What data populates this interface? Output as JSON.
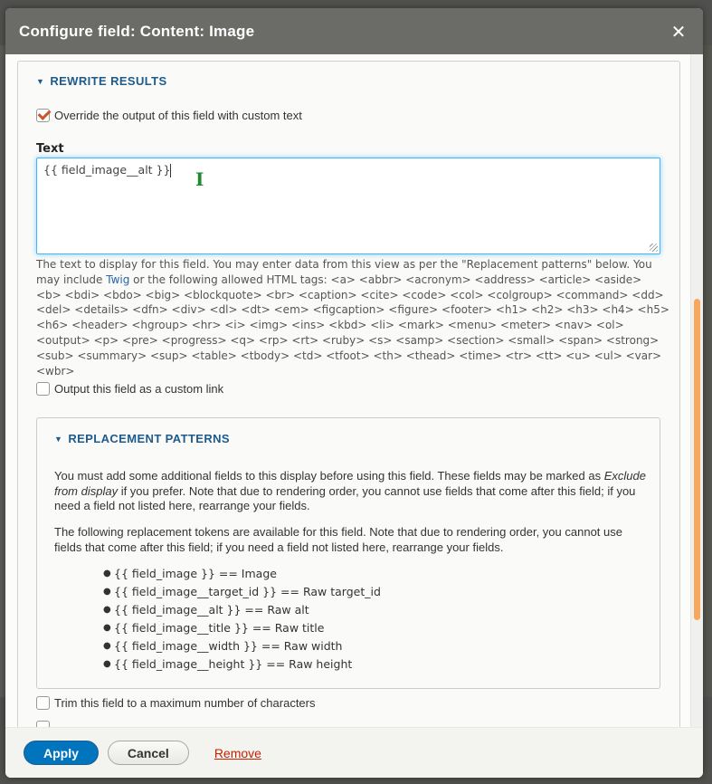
{
  "dialog": {
    "title": "Configure field: Content: Image",
    "close_icon": "close-icon"
  },
  "rewrite": {
    "legend": "REWRITE RESULTS",
    "override_checkbox": {
      "label": "Override the output of this field with custom text",
      "checked": true
    },
    "text_label": "Text",
    "text_value": "{{ field_image__alt }}",
    "help_prefix": "The text to display for this field. You may enter data from this view as per the \"Replacement patterns\" below. You may include ",
    "help_link": "Twig",
    "help_suffix": " or the following allowed HTML tags: <a> <abbr> <acronym> <address> <article> <aside> <b> <bdi> <bdo> <big> <blockquote> <br> <caption> <cite> <code> <col> <colgroup> <command> <dd> <del> <details> <dfn> <div> <dl> <dt> <em> <figcaption> <figure> <footer> <h1> <h2> <h3> <h4> <h5> <h6> <header> <hgroup> <hr> <i> <img> <ins> <kbd> <li> <mark> <menu> <meter> <nav> <ol> <output> <p> <pre> <progress> <q> <rp> <rt> <ruby> <s> <samp> <section> <small> <span> <strong> <sub> <summary> <sup> <table> <tbody> <td> <tfoot> <th> <thead> <time> <tr> <tt> <u> <ul> <var> <wbr>",
    "custom_link_checkbox": {
      "label": "Output this field as a custom link",
      "checked": false
    },
    "trim_checkbox": {
      "label": "Trim this field to a maximum number of characters",
      "checked": false
    }
  },
  "replacement": {
    "legend": "REPLACEMENT PATTERNS",
    "para1_a": "You must add some additional fields to this display before using this field. These fields may be marked as ",
    "para1_em": "Exclude from display",
    "para1_b": " if you prefer. Note that due to rendering order, you cannot use fields that come after this field; if you need a field not listed here, rearrange your fields.",
    "para2": "The following replacement tokens are available for this field. Note that due to rendering order, you cannot use fields that come after this field; if you need a field not listed here, rearrange your fields.",
    "tokens": [
      "{{ field_image }} == Image",
      "{{ field_image__target_id }} == Raw target_id",
      "{{ field_image__alt }} == Raw alt",
      "{{ field_image__title }} == Raw title",
      "{{ field_image__width }} == Raw width",
      "{{ field_image__height }} == Raw height"
    ]
  },
  "footer": {
    "apply": "Apply",
    "cancel": "Cancel",
    "remove": "Remove"
  },
  "colors": {
    "primary": "#0074bd",
    "legend": "#1d5b8c",
    "remove_link": "#c72100",
    "scrollbar": "#f7a85c"
  }
}
